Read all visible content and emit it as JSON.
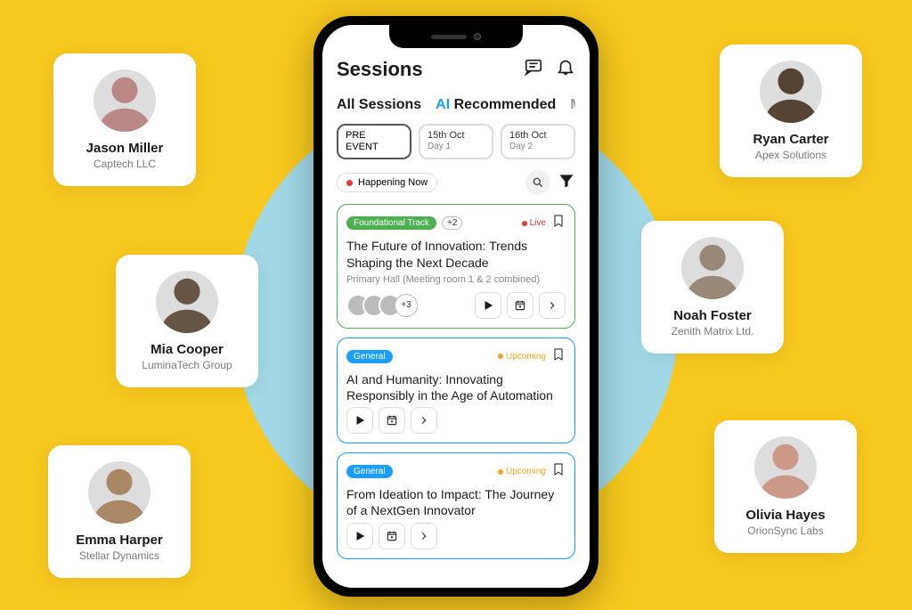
{
  "people": [
    {
      "name": "Jason Miller",
      "company": "Captech LLC"
    },
    {
      "name": "Mia Cooper",
      "company": "LuminaTech Group"
    },
    {
      "name": "Emma Harper",
      "company": "Stellar Dynamics"
    },
    {
      "name": "Ryan Carter",
      "company": "Apex Solutions"
    },
    {
      "name": "Noah Foster",
      "company": "Zenith Matrix Ltd."
    },
    {
      "name": "Olivia Hayes",
      "company": "OrionSync Labs"
    }
  ],
  "header": {
    "title": "Sessions"
  },
  "tabs": {
    "all": "All Sessions",
    "ai": "AI",
    "aiRec": "Recommended",
    "my": "My"
  },
  "datePills": [
    {
      "line1": "PRE",
      "line2": "EVENT"
    },
    {
      "line1": "15th Oct",
      "line2": "Day 1"
    },
    {
      "line1": "16th Oct",
      "line2": "Day 2"
    }
  ],
  "happening": "Happening Now",
  "sessions": [
    {
      "badge": "Foundational Track",
      "plus": "+2",
      "status": "Live",
      "title": "The Future of Innovation: Trends Shaping the Next Decade",
      "sub": "Primary Hall (Meeting room 1 & 2 combined)",
      "avatarsPlus": "+3"
    },
    {
      "badge": "General",
      "status": "Upcoming",
      "title": "AI and Humanity: Innovating Responsibly in the Age of Automation"
    },
    {
      "badge": "General",
      "status": "Upcoming",
      "title": "From Ideation to Impact: The Journey of a NextGen Innovator"
    }
  ]
}
